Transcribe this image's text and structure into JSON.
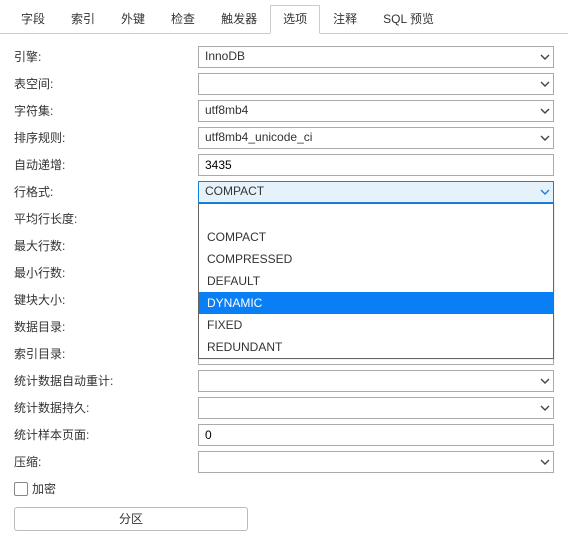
{
  "tabs": [
    {
      "label": "字段"
    },
    {
      "label": "索引"
    },
    {
      "label": "外键"
    },
    {
      "label": "检查"
    },
    {
      "label": "触发器"
    },
    {
      "label": "选项",
      "active": true
    },
    {
      "label": "注释"
    },
    {
      "label": "SQL 预览"
    }
  ],
  "form": {
    "engine": {
      "label": "引擎:",
      "value": "InnoDB"
    },
    "tablespace": {
      "label": "表空间:",
      "value": ""
    },
    "charset": {
      "label": "字符集:",
      "value": "utf8mb4"
    },
    "collation": {
      "label": "排序规则:",
      "value": "utf8mb4_unicode_ci"
    },
    "autoinc": {
      "label": "自动递增:",
      "value": "3435"
    },
    "rowformat": {
      "label": "行格式:",
      "value": "COMPACT"
    },
    "avgrowlen": {
      "label": "平均行长度:",
      "value": ""
    },
    "maxrows": {
      "label": "最大行数:",
      "value": ""
    },
    "minrows": {
      "label": "最小行数:",
      "value": ""
    },
    "keyblocksize": {
      "label": "键块大小:",
      "value": ""
    },
    "datadir": {
      "label": "数据目录:",
      "value": ""
    },
    "indexdir": {
      "label": "索引目录:",
      "value": ""
    },
    "statsautorecalc": {
      "label": "统计数据自动重计:",
      "value": ""
    },
    "statspersistent": {
      "label": "统计数据持久:",
      "value": ""
    },
    "statssamplepages": {
      "label": "统计样本页面:",
      "value": "0"
    },
    "compression": {
      "label": "压缩:",
      "value": ""
    },
    "encrypt": {
      "label": "加密"
    }
  },
  "rowformat_dropdown": {
    "options": [
      "",
      "COMPACT",
      "COMPRESSED",
      "DEFAULT",
      "DYNAMIC",
      "FIXED",
      "REDUNDANT"
    ],
    "hovered_index": 4
  },
  "partition_button": "分区",
  "icons": {
    "dropdown_arrow": "▾"
  }
}
